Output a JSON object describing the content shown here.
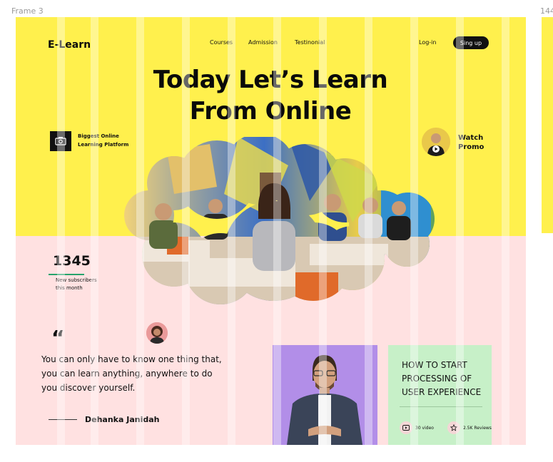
{
  "frame": {
    "label": "Frame 3",
    "right_label": "144"
  },
  "header": {
    "logo": "E-Learn",
    "nav": [
      "Courses",
      "Admission",
      "Testinonial"
    ],
    "login": "Log-in",
    "signup": "Sing up"
  },
  "hero": {
    "title_line1": "Today Let’s Learn",
    "title_line2": "From Online",
    "badge_line1": "Biggest Online",
    "badge_line2": "Learning Platform",
    "promo_line1": "Watch",
    "promo_line2": "Promo"
  },
  "stats": {
    "number": "1345",
    "label_line1": "New subscribers",
    "label_line2": "this month"
  },
  "testimonial": {
    "quote_mark": "“",
    "line1": "You can only have to know one thing that,",
    "line2": "you can learn anything, anywhere to do",
    "line3": "you discover yourself.",
    "author": "Dehanka Janidah"
  },
  "course": {
    "title_line1": "HOW TO START",
    "title_line2": "PROCESSING OF",
    "title_line3": "USER EXPERIENCE",
    "videos": "30 video",
    "reviews": "2.5K Reviews"
  },
  "icons": {
    "badge": "certificate-icon",
    "play": "play-icon",
    "video": "video-icon",
    "star": "star-icon"
  },
  "colors": {
    "yellow": "#fff04d",
    "pink": "#ffe1e1",
    "purple": "#b28ee8",
    "green": "#c7f0c8",
    "dark": "#111111"
  }
}
